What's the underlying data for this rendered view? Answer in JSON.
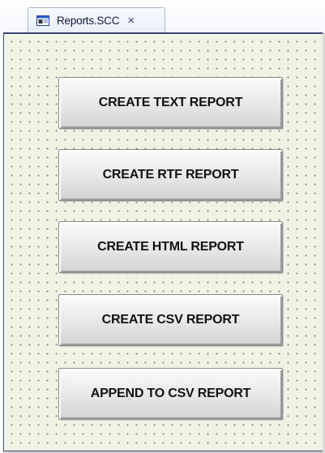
{
  "tab": {
    "title": "Reports.SCC",
    "close_glyph": "×",
    "icon": "screen-document-icon"
  },
  "buttons": [
    {
      "label": "CREATE TEXT REPORT"
    },
    {
      "label": "CREATE RTF REPORT"
    },
    {
      "label": "CREATE HTML REPORT"
    },
    {
      "label": "CREATE CSV REPORT"
    },
    {
      "label": "APPEND TO CSV REPORT"
    }
  ],
  "colors": {
    "canvas_background": "#eef3e3",
    "grid_dot": "#7f8575",
    "frame_border": "#35426e",
    "button_face": "#e6e6e6"
  }
}
